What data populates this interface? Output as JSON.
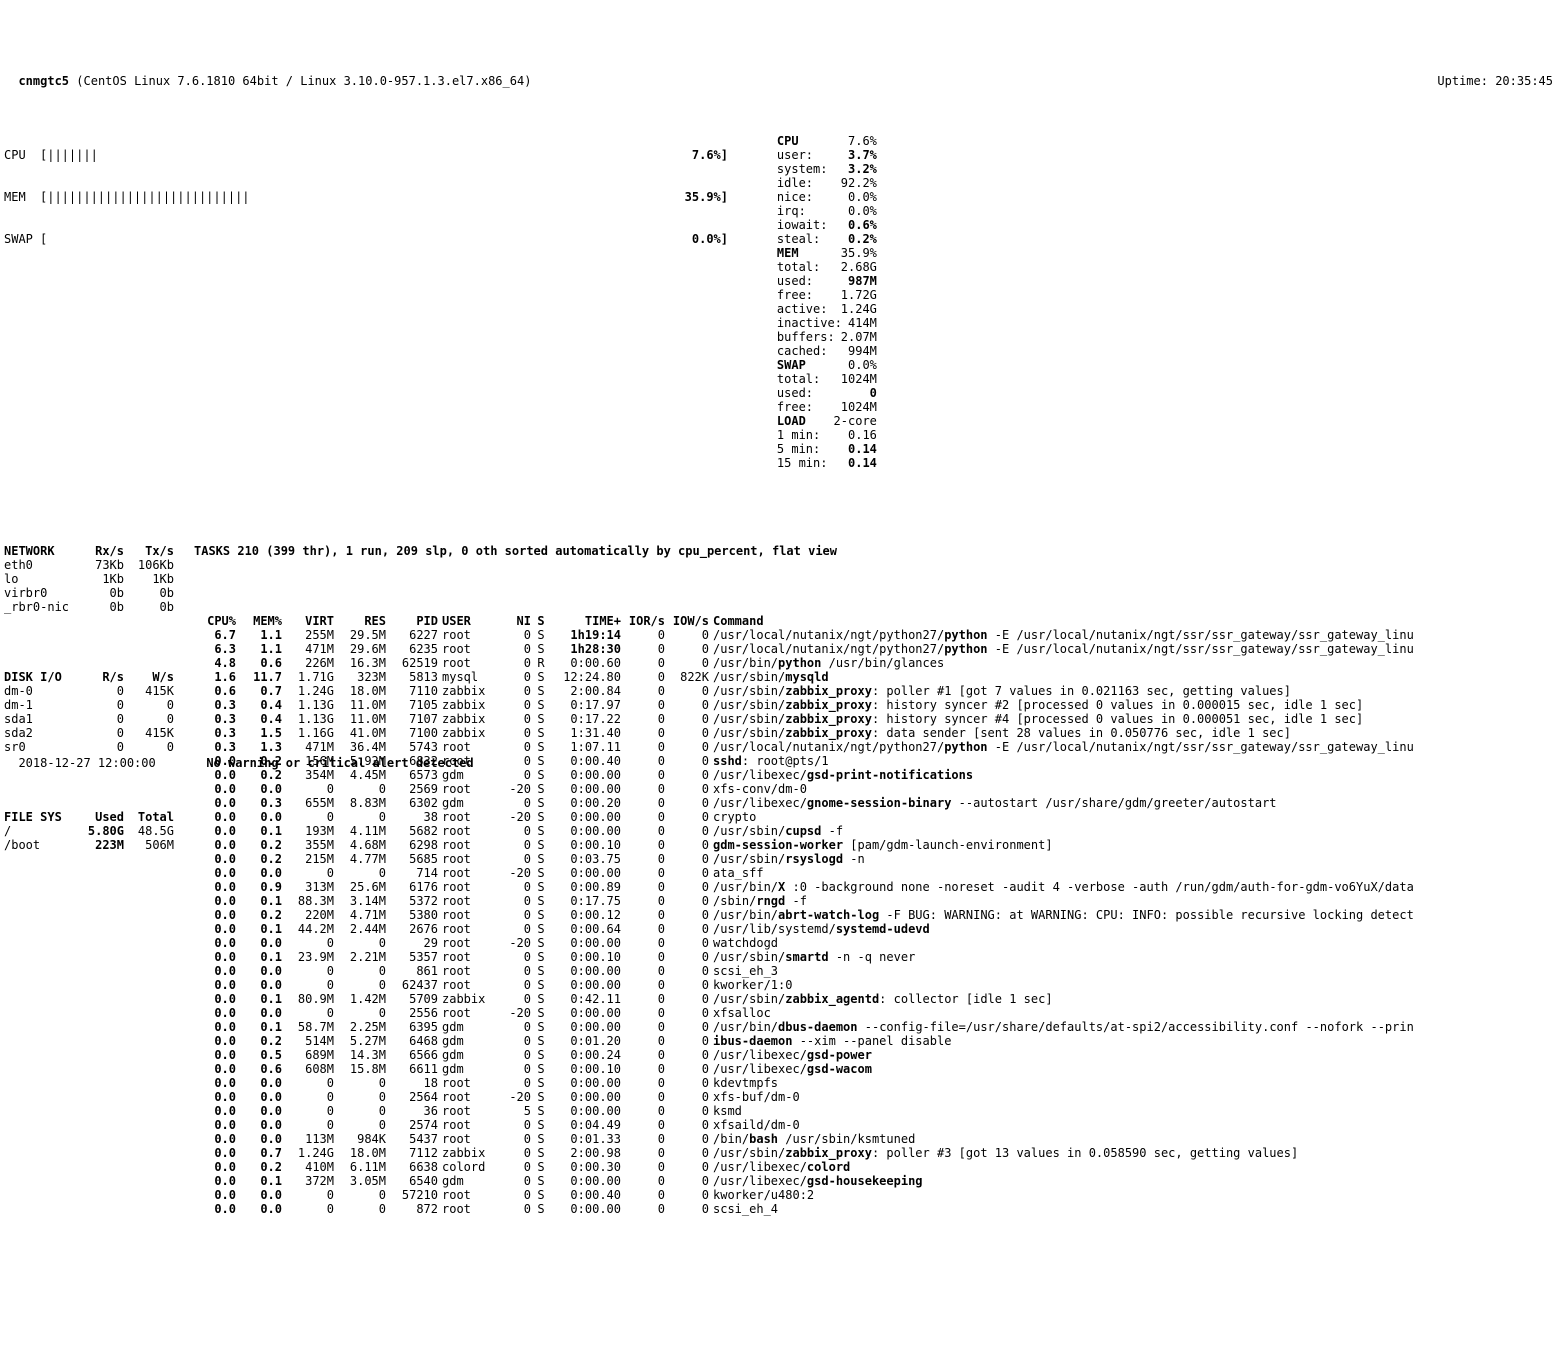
{
  "header": {
    "host": "cnmgtc5",
    "os": "(CentOS Linux 7.6.1810 64bit / Linux 3.10.0-957.1.3.el7.x86_64)",
    "uptime": "Uptime: 20:35:45"
  },
  "bars": {
    "cpu": {
      "label": "CPU",
      "track": "[|||||||                                                                         ",
      "pct": "7.6%]"
    },
    "mem": {
      "label": "MEM",
      "track": "[||||||||||||||||||||||||||||                                                    ",
      "pct": "35.9%]"
    },
    "swap": {
      "label": "SWAP",
      "track": "[                                                                                 ",
      "pct": "0.0%]"
    }
  },
  "cpu": {
    "hdr": "CPU",
    "t": "7.6%",
    "user": "3.7%",
    "system": "3.2%",
    "idle": "92.2%",
    "nice": "0.0%",
    "irq": "0.0%",
    "iowait": "0.6%",
    "steal": "0.2%"
  },
  "mem": {
    "hdr": "MEM",
    "t": "35.9%",
    "total": "2.68G",
    "used": "987M",
    "free": "1.72G",
    "active": "1.24G",
    "inactive": "414M",
    "buffers": "2.07M",
    "cached": "994M"
  },
  "swap": {
    "hdr": "SWAP",
    "t": "0.0%",
    "total": "1024M",
    "used": "0",
    "free": "1024M"
  },
  "load": {
    "hdr": "LOAD",
    "core": "2-core",
    "m1": "0.16",
    "m5": "0.14",
    "m15": "0.14"
  },
  "network": {
    "hdr": [
      "NETWORK",
      "Rx/s",
      "Tx/s"
    ],
    "rows": [
      [
        "eth0",
        "73Kb",
        "106Kb"
      ],
      [
        "lo",
        "1Kb",
        "1Kb"
      ],
      [
        "virbr0",
        "0b",
        "0b"
      ],
      [
        "_rbr0-nic",
        "0b",
        "0b"
      ]
    ]
  },
  "disk": {
    "hdr": [
      "DISK I/O",
      "R/s",
      "W/s"
    ],
    "rows": [
      [
        "dm-0",
        "0",
        "415K"
      ],
      [
        "dm-1",
        "0",
        "0"
      ],
      [
        "sda1",
        "0",
        "0"
      ],
      [
        "sda2",
        "0",
        "415K"
      ],
      [
        "sr0",
        "0",
        "0"
      ]
    ]
  },
  "fs": {
    "hdr": [
      "FILE SYS",
      "Used",
      "Total"
    ],
    "rows": [
      [
        "/",
        "5.80G",
        "48.5G",
        true
      ],
      [
        "/boot",
        "223M",
        "506M",
        true
      ]
    ]
  },
  "tasks": {
    "summary": "TASKS 210 (399 thr), 1 run, 209 slp, 0 oth sorted automatically by cpu_percent, flat view",
    "cols": [
      "CPU%",
      "MEM%",
      "VIRT",
      "RES",
      "PID",
      "USER",
      "NI",
      "S",
      "TIME+",
      "IOR/s",
      "IOW/s",
      "Command"
    ],
    "rows": [
      {
        "cpu": "6.7",
        "mem": "1.1",
        "virt": "255M",
        "res": "29.5M",
        "pid": "6227",
        "user": "root",
        "ni": "0",
        "s": "S",
        "time": "1h19:14",
        "tb": true,
        "ior": "0",
        "iow": "0",
        "cmd": "/usr/local/nutanix/ngt/python27/<b>python</b> -E /usr/local/nutanix/ngt/ssr/ssr_gateway/ssr_gateway_linu"
      },
      {
        "cpu": "6.3",
        "mem": "1.1",
        "virt": "471M",
        "res": "29.6M",
        "pid": "6235",
        "user": "root",
        "ni": "0",
        "s": "S",
        "time": "1h28:30",
        "tb": true,
        "ior": "0",
        "iow": "0",
        "cmd": "/usr/local/nutanix/ngt/python27/<b>python</b> -E /usr/local/nutanix/ngt/ssr/ssr_gateway/ssr_gateway_linu"
      },
      {
        "cpu": "4.8",
        "mem": "0.6",
        "virt": "226M",
        "res": "16.3M",
        "pid": "62519",
        "user": "root",
        "ni": "0",
        "s": "R",
        "time": "0:00.60",
        "ior": "0",
        "iow": "0",
        "cmd": "/usr/bin/<b>python</b> /usr/bin/glances"
      },
      {
        "cpu": "1.6",
        "mem": "11.7",
        "virt": "1.71G",
        "res": "323M",
        "pid": "5813",
        "user": "mysql",
        "ni": "0",
        "s": "S",
        "time": "12:24.80",
        "ior": "0",
        "iow": "822K",
        "cmd": "/usr/sbin/<b>mysqld</b>"
      },
      {
        "cpu": "0.6",
        "mem": "0.7",
        "virt": "1.24G",
        "res": "18.0M",
        "pid": "7110",
        "user": "zabbix",
        "ni": "0",
        "s": "S",
        "time": "2:00.84",
        "ior": "0",
        "iow": "0",
        "cmd": "/usr/sbin/<b>zabbix_proxy</b>: poller #1 [got 7 values in 0.021163 sec, getting values]"
      },
      {
        "cpu": "0.3",
        "mem": "0.4",
        "virt": "1.13G",
        "res": "11.0M",
        "pid": "7105",
        "user": "zabbix",
        "ni": "0",
        "s": "S",
        "time": "0:17.97",
        "ior": "0",
        "iow": "0",
        "cmd": "/usr/sbin/<b>zabbix_proxy</b>: history syncer #2 [processed 0 values in 0.000015 sec, idle 1 sec]"
      },
      {
        "cpu": "0.3",
        "mem": "0.4",
        "virt": "1.13G",
        "res": "11.0M",
        "pid": "7107",
        "user": "zabbix",
        "ni": "0",
        "s": "S",
        "time": "0:17.22",
        "ior": "0",
        "iow": "0",
        "cmd": "/usr/sbin/<b>zabbix_proxy</b>: history syncer #4 [processed 0 values in 0.000051 sec, idle 1 sec]"
      },
      {
        "cpu": "0.3",
        "mem": "1.5",
        "virt": "1.16G",
        "res": "41.0M",
        "pid": "7100",
        "user": "zabbix",
        "ni": "0",
        "s": "S",
        "time": "1:31.40",
        "ior": "0",
        "iow": "0",
        "cmd": "/usr/sbin/<b>zabbix_proxy</b>: data sender [sent 28 values in 0.050776 sec, idle 1 sec]"
      },
      {
        "cpu": "0.3",
        "mem": "1.3",
        "virt": "471M",
        "res": "36.4M",
        "pid": "5743",
        "user": "root",
        "ni": "0",
        "s": "S",
        "time": "1:07.11",
        "ior": "0",
        "iow": "0",
        "cmd": "/usr/local/nutanix/ngt/python27/<b>python</b> -E /usr/local/nutanix/ngt/ssr/ssr_gateway/ssr_gateway_linu"
      },
      {
        "cpu": "0.0",
        "mem": "0.2",
        "virt": "156M",
        "res": "5.92M",
        "pid": "6832",
        "user": "root",
        "ni": "0",
        "s": "S",
        "time": "0:00.40",
        "ior": "0",
        "iow": "0",
        "cmd": "<b>sshd</b>: root@pts/1"
      },
      {
        "cpu": "0.0",
        "mem": "0.2",
        "virt": "354M",
        "res": "4.45M",
        "pid": "6573",
        "user": "gdm",
        "ni": "0",
        "s": "S",
        "time": "0:00.00",
        "ior": "0",
        "iow": "0",
        "cmd": "/usr/libexec/<b>gsd-print-notifications</b>"
      },
      {
        "cpu": "0.0",
        "mem": "0.0",
        "virt": "0",
        "res": "0",
        "pid": "2569",
        "user": "root",
        "ni": "-20",
        "s": "S",
        "time": "0:00.00",
        "ior": "0",
        "iow": "0",
        "cmd": "xfs-conv/dm-0"
      },
      {
        "cpu": "0.0",
        "mem": "0.3",
        "virt": "655M",
        "res": "8.83M",
        "pid": "6302",
        "user": "gdm",
        "ni": "0",
        "s": "S",
        "time": "0:00.20",
        "ior": "0",
        "iow": "0",
        "cmd": "/usr/libexec/<b>gnome-session-binary</b> --autostart /usr/share/gdm/greeter/autostart"
      },
      {
        "cpu": "0.0",
        "mem": "0.0",
        "virt": "0",
        "res": "0",
        "pid": "38",
        "user": "root",
        "ni": "-20",
        "s": "S",
        "time": "0:00.00",
        "ior": "0",
        "iow": "0",
        "cmd": "crypto"
      },
      {
        "cpu": "0.0",
        "mem": "0.1",
        "virt": "193M",
        "res": "4.11M",
        "pid": "5682",
        "user": "root",
        "ni": "0",
        "s": "S",
        "time": "0:00.00",
        "ior": "0",
        "iow": "0",
        "cmd": "/usr/sbin/<b>cupsd</b> -f"
      },
      {
        "cpu": "0.0",
        "mem": "0.2",
        "virt": "355M",
        "res": "4.68M",
        "pid": "6298",
        "user": "root",
        "ni": "0",
        "s": "S",
        "time": "0:00.10",
        "ior": "0",
        "iow": "0",
        "cmd": "<b>gdm-session-worker</b> [pam/gdm-launch-environment]"
      },
      {
        "cpu": "0.0",
        "mem": "0.2",
        "virt": "215M",
        "res": "4.77M",
        "pid": "5685",
        "user": "root",
        "ni": "0",
        "s": "S",
        "time": "0:03.75",
        "ior": "0",
        "iow": "0",
        "cmd": "/usr/sbin/<b>rsyslogd</b> -n"
      },
      {
        "cpu": "0.0",
        "mem": "0.0",
        "virt": "0",
        "res": "0",
        "pid": "714",
        "user": "root",
        "ni": "-20",
        "s": "S",
        "time": "0:00.00",
        "ior": "0",
        "iow": "0",
        "cmd": "ata_sff"
      },
      {
        "cpu": "0.0",
        "mem": "0.9",
        "virt": "313M",
        "res": "25.6M",
        "pid": "6176",
        "user": "root",
        "ni": "0",
        "s": "S",
        "time": "0:00.89",
        "ior": "0",
        "iow": "0",
        "cmd": "/usr/bin/<b>X</b> :0 -background none -noreset -audit 4 -verbose -auth /run/gdm/auth-for-gdm-vo6YuX/data"
      },
      {
        "cpu": "0.0",
        "mem": "0.1",
        "virt": "88.3M",
        "res": "3.14M",
        "pid": "5372",
        "user": "root",
        "ni": "0",
        "s": "S",
        "time": "0:17.75",
        "ior": "0",
        "iow": "0",
        "cmd": "/sbin/<b>rngd</b> -f"
      },
      {
        "cpu": "0.0",
        "mem": "0.2",
        "virt": "220M",
        "res": "4.71M",
        "pid": "5380",
        "user": "root",
        "ni": "0",
        "s": "S",
        "time": "0:00.12",
        "ior": "0",
        "iow": "0",
        "cmd": "/usr/bin/<b>abrt-watch-log</b> -F BUG: WARNING: at WARNING: CPU: INFO: possible recursive locking detect"
      },
      {
        "cpu": "0.0",
        "mem": "0.1",
        "virt": "44.2M",
        "res": "2.44M",
        "pid": "2676",
        "user": "root",
        "ni": "0",
        "s": "S",
        "time": "0:00.64",
        "ior": "0",
        "iow": "0",
        "cmd": "/usr/lib/systemd/<b>systemd-udevd</b>"
      },
      {
        "cpu": "0.0",
        "mem": "0.0",
        "virt": "0",
        "res": "0",
        "pid": "29",
        "user": "root",
        "ni": "-20",
        "s": "S",
        "time": "0:00.00",
        "ior": "0",
        "iow": "0",
        "cmd": "watchdogd"
      },
      {
        "cpu": "0.0",
        "mem": "0.1",
        "virt": "23.9M",
        "res": "2.21M",
        "pid": "5357",
        "user": "root",
        "ni": "0",
        "s": "S",
        "time": "0:00.10",
        "ior": "0",
        "iow": "0",
        "cmd": "/usr/sbin/<b>smartd</b> -n -q never"
      },
      {
        "cpu": "0.0",
        "mem": "0.0",
        "virt": "0",
        "res": "0",
        "pid": "861",
        "user": "root",
        "ni": "0",
        "s": "S",
        "time": "0:00.00",
        "ior": "0",
        "iow": "0",
        "cmd": "scsi_eh_3"
      },
      {
        "cpu": "0.0",
        "mem": "0.0",
        "virt": "0",
        "res": "0",
        "pid": "62437",
        "user": "root",
        "ni": "0",
        "s": "S",
        "time": "0:00.00",
        "ior": "0",
        "iow": "0",
        "cmd": "kworker/1:0"
      },
      {
        "cpu": "0.0",
        "mem": "0.1",
        "virt": "80.9M",
        "res": "1.42M",
        "pid": "5709",
        "user": "zabbix",
        "ni": "0",
        "s": "S",
        "time": "0:42.11",
        "ior": "0",
        "iow": "0",
        "cmd": "/usr/sbin/<b>zabbix_agentd</b>: collector [idle 1 sec]"
      },
      {
        "cpu": "0.0",
        "mem": "0.0",
        "virt": "0",
        "res": "0",
        "pid": "2556",
        "user": "root",
        "ni": "-20",
        "s": "S",
        "time": "0:00.00",
        "ior": "0",
        "iow": "0",
        "cmd": "xfsalloc"
      },
      {
        "cpu": "0.0",
        "mem": "0.1",
        "virt": "58.7M",
        "res": "2.25M",
        "pid": "6395",
        "user": "gdm",
        "ni": "0",
        "s": "S",
        "time": "0:00.00",
        "ior": "0",
        "iow": "0",
        "cmd": "/usr/bin/<b>dbus-daemon</b> --config-file=/usr/share/defaults/at-spi2/accessibility.conf --nofork --prin"
      },
      {
        "cpu": "0.0",
        "mem": "0.2",
        "virt": "514M",
        "res": "5.27M",
        "pid": "6468",
        "user": "gdm",
        "ni": "0",
        "s": "S",
        "time": "0:01.20",
        "ior": "0",
        "iow": "0",
        "cmd": "<b>ibus-daemon</b> --xim --panel disable"
      },
      {
        "cpu": "0.0",
        "mem": "0.5",
        "virt": "689M",
        "res": "14.3M",
        "pid": "6566",
        "user": "gdm",
        "ni": "0",
        "s": "S",
        "time": "0:00.24",
        "ior": "0",
        "iow": "0",
        "cmd": "/usr/libexec/<b>gsd-power</b>"
      },
      {
        "cpu": "0.0",
        "mem": "0.6",
        "virt": "608M",
        "res": "15.8M",
        "pid": "6611",
        "user": "gdm",
        "ni": "0",
        "s": "S",
        "time": "0:00.10",
        "ior": "0",
        "iow": "0",
        "cmd": "/usr/libexec/<b>gsd-wacom</b>"
      },
      {
        "cpu": "0.0",
        "mem": "0.0",
        "virt": "0",
        "res": "0",
        "pid": "18",
        "user": "root",
        "ni": "0",
        "s": "S",
        "time": "0:00.00",
        "ior": "0",
        "iow": "0",
        "cmd": "kdevtmpfs"
      },
      {
        "cpu": "0.0",
        "mem": "0.0",
        "virt": "0",
        "res": "0",
        "pid": "2564",
        "user": "root",
        "ni": "-20",
        "s": "S",
        "time": "0:00.00",
        "ior": "0",
        "iow": "0",
        "cmd": "xfs-buf/dm-0"
      },
      {
        "cpu": "0.0",
        "mem": "0.0",
        "virt": "0",
        "res": "0",
        "pid": "36",
        "user": "root",
        "ni": "5",
        "s": "S",
        "time": "0:00.00",
        "ior": "0",
        "iow": "0",
        "cmd": "ksmd"
      },
      {
        "cpu": "0.0",
        "mem": "0.0",
        "virt": "0",
        "res": "0",
        "pid": "2574",
        "user": "root",
        "ni": "0",
        "s": "S",
        "time": "0:04.49",
        "ior": "0",
        "iow": "0",
        "cmd": "xfsaild/dm-0"
      },
      {
        "cpu": "0.0",
        "mem": "0.0",
        "virt": "113M",
        "res": "984K",
        "pid": "5437",
        "user": "root",
        "ni": "0",
        "s": "S",
        "time": "0:01.33",
        "ior": "0",
        "iow": "0",
        "cmd": "/bin/<b>bash</b> /usr/sbin/ksmtuned"
      },
      {
        "cpu": "0.0",
        "mem": "0.7",
        "virt": "1.24G",
        "res": "18.0M",
        "pid": "7112",
        "user": "zabbix",
        "ni": "0",
        "s": "S",
        "time": "2:00.98",
        "ior": "0",
        "iow": "0",
        "cmd": "/usr/sbin/<b>zabbix_proxy</b>: poller #3 [got 13 values in 0.058590 sec, getting values]"
      },
      {
        "cpu": "0.0",
        "mem": "0.2",
        "virt": "410M",
        "res": "6.11M",
        "pid": "6638",
        "user": "colord",
        "ni": "0",
        "s": "S",
        "time": "0:00.30",
        "ior": "0",
        "iow": "0",
        "cmd": "/usr/libexec/<b>colord</b>"
      },
      {
        "cpu": "0.0",
        "mem": "0.1",
        "virt": "372M",
        "res": "3.05M",
        "pid": "6540",
        "user": "gdm",
        "ni": "0",
        "s": "S",
        "time": "0:00.00",
        "ior": "0",
        "iow": "0",
        "cmd": "/usr/libexec/<b>gsd-housekeeping</b>"
      },
      {
        "cpu": "0.0",
        "mem": "0.0",
        "virt": "0",
        "res": "0",
        "pid": "57210",
        "user": "root",
        "ni": "0",
        "s": "S",
        "time": "0:00.40",
        "ior": "0",
        "iow": "0",
        "cmd": "kworker/u480:2"
      },
      {
        "cpu": "0.0",
        "mem": "0.0",
        "virt": "0",
        "res": "0",
        "pid": "872",
        "user": "root",
        "ni": "0",
        "s": "S",
        "time": "0:00.00",
        "ior": "0",
        "iow": "0",
        "cmd": "scsi_eh_4"
      }
    ]
  },
  "footer": {
    "ts": "2018-12-27 12:00:00",
    "msg": "No warning or critical alert detected"
  }
}
